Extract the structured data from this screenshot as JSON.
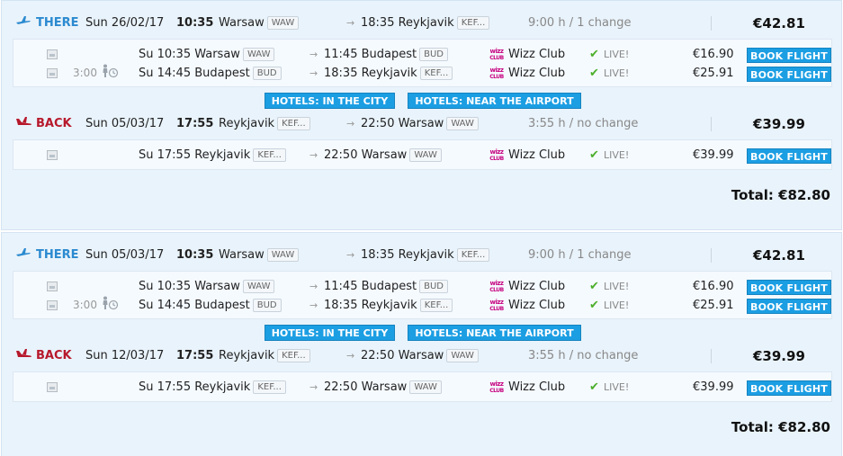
{
  "icons": {
    "there": "plane-takeoff-icon",
    "back": "plane-landing-icon",
    "thumbnail": "image-placeholder-icon",
    "layover": "person-clock-icon",
    "arrow": "arrow-right-icon",
    "live": "checkmark-icon",
    "carrier_logo": "wizz-air-logo"
  },
  "colors": {
    "there": "#2b8ad0",
    "back": "#b7192c",
    "button": "#1c9ee3",
    "panel": "#e9f3fb",
    "live_check": "#4caf2a"
  },
  "itineraries": [
    {
      "there": {
        "label": "THERE",
        "date": "Sun 26/02/17",
        "dep_time": "10:35",
        "dep_city": "Warsaw",
        "dep_code": "WAW",
        "arrow": "→",
        "arr_time": "18:35",
        "arr_city": "Reykjavik",
        "arr_code": "KEF...",
        "duration": "9:00 h / 1 change",
        "price": "€42.81",
        "legs": [
          {
            "layover": "",
            "dep": "Su 10:35 Warsaw",
            "dep_code": "WAW",
            "arrow": "→",
            "arr": "11:45 Budapest",
            "arr_code": "BUD",
            "logo": "wizz CLUB",
            "carrier": "Wizz Club",
            "check": "✔",
            "live": "LIVE!",
            "price": "€16.90",
            "book": "BOOK FLIGHT"
          },
          {
            "layover": "3:00",
            "dep": "Su 14:45 Budapest",
            "dep_code": "BUD",
            "arrow": "→",
            "arr": "18:35 Reykjavik",
            "arr_code": "KEF...",
            "logo": "wizz CLUB",
            "carrier": "Wizz Club",
            "check": "✔",
            "live": "LIVE!",
            "price": "€25.91",
            "book": "BOOK FLIGHT"
          }
        ]
      },
      "hotels": {
        "city": "HOTELS: IN THE CITY",
        "airport": "HOTELS: NEAR THE AIRPORT"
      },
      "back": {
        "label": "BACK",
        "date": "Sun 05/03/17",
        "dep_time": "17:55",
        "dep_city": "Reykjavik",
        "dep_code": "KEF...",
        "arrow": "→",
        "arr_time": "22:50",
        "arr_city": "Warsaw",
        "arr_code": "WAW",
        "duration": "3:55 h / no change",
        "price": "€39.99",
        "legs": [
          {
            "layover": "",
            "dep": "Su 17:55 Reykjavik",
            "dep_code": "KEF...",
            "arrow": "→",
            "arr": "22:50 Warsaw",
            "arr_code": "WAW",
            "logo": "wizz CLUB",
            "carrier": "Wizz Club",
            "check": "✔",
            "live": "LIVE!",
            "price": "€39.99",
            "book": "BOOK FLIGHT"
          }
        ]
      },
      "total": "Total: €82.80"
    },
    {
      "there": {
        "label": "THERE",
        "date": "Sun 05/03/17",
        "dep_time": "10:35",
        "dep_city": "Warsaw",
        "dep_code": "WAW",
        "arrow": "→",
        "arr_time": "18:35",
        "arr_city": "Reykjavik",
        "arr_code": "KEF...",
        "duration": "9:00 h / 1 change",
        "price": "€42.81",
        "legs": [
          {
            "layover": "",
            "dep": "Su 10:35 Warsaw",
            "dep_code": "WAW",
            "arrow": "→",
            "arr": "11:45 Budapest",
            "arr_code": "BUD",
            "logo": "wizz CLUB",
            "carrier": "Wizz Club",
            "check": "✔",
            "live": "LIVE!",
            "price": "€16.90",
            "book": "BOOK FLIGHT"
          },
          {
            "layover": "3:00",
            "dep": "Su 14:45 Budapest",
            "dep_code": "BUD",
            "arrow": "→",
            "arr": "18:35 Reykjavik",
            "arr_code": "KEF...",
            "logo": "wizz CLUB",
            "carrier": "Wizz Club",
            "check": "✔",
            "live": "LIVE!",
            "price": "€25.91",
            "book": "BOOK FLIGHT"
          }
        ]
      },
      "hotels": {
        "city": "HOTELS: IN THE CITY",
        "airport": "HOTELS: NEAR THE AIRPORT"
      },
      "back": {
        "label": "BACK",
        "date": "Sun 12/03/17",
        "dep_time": "17:55",
        "dep_city": "Reykjavik",
        "dep_code": "KEF...",
        "arrow": "→",
        "arr_time": "22:50",
        "arr_city": "Warsaw",
        "arr_code": "WAW",
        "duration": "3:55 h / no change",
        "price": "€39.99",
        "legs": [
          {
            "layover": "",
            "dep": "Su 17:55 Reykjavik",
            "dep_code": "KEF...",
            "arrow": "→",
            "arr": "22:50 Warsaw",
            "arr_code": "WAW",
            "logo": "wizz CLUB",
            "carrier": "Wizz Club",
            "check": "✔",
            "live": "LIVE!",
            "price": "€39.99",
            "book": "BOOK FLIGHT"
          }
        ]
      },
      "total": "Total: €82.80"
    }
  ]
}
